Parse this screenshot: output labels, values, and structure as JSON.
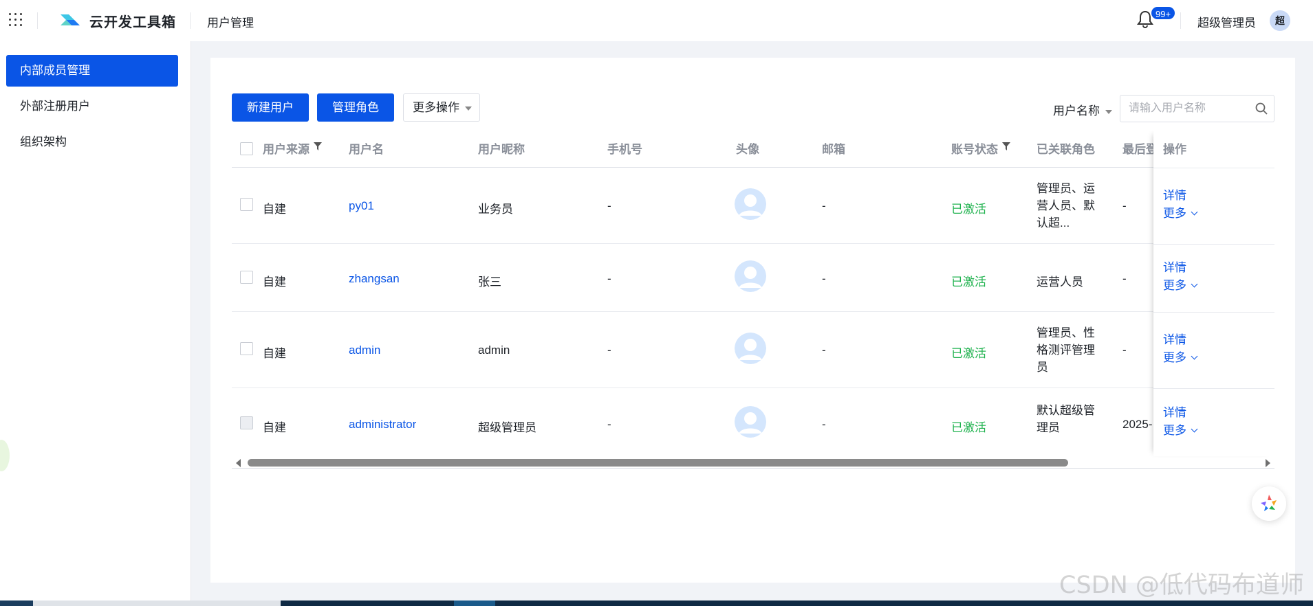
{
  "header": {
    "app_name": "云开发工具箱",
    "page_name": "用户管理",
    "notification_count": "99+",
    "user_name": "超级管理员",
    "avatar_char": "超"
  },
  "sidebar": {
    "items": [
      {
        "label": "内部成员管理",
        "active": true
      },
      {
        "label": "外部注册用户",
        "active": false
      },
      {
        "label": "组织架构",
        "active": false
      }
    ]
  },
  "toolbar": {
    "new_user": "新建用户",
    "manage_roles": "管理角色",
    "more_actions": "更多操作",
    "search_type": "用户名称",
    "search_placeholder": "请输入用户名称"
  },
  "table": {
    "columns": [
      "用户来源",
      "用户名",
      "用户昵称",
      "手机号",
      "头像",
      "邮箱",
      "账号状态",
      "已关联角色",
      "最后登录",
      "操作"
    ],
    "rows": [
      {
        "source": "自建",
        "username": "py01",
        "nickname": "业务员",
        "phone": "-",
        "email": "-",
        "status": "已激活",
        "roles": "管理员、运营人员、默认超...",
        "last_login": "-"
      },
      {
        "source": "自建",
        "username": "zhangsan",
        "nickname": "张三",
        "phone": "-",
        "email": "-",
        "status": "已激活",
        "roles": "运营人员",
        "last_login": "-"
      },
      {
        "source": "自建",
        "username": "admin",
        "nickname": "admin",
        "phone": "-",
        "email": "-",
        "status": "已激活",
        "roles": "管理员、性格测评管理员",
        "last_login": "-"
      },
      {
        "source": "自建",
        "username": "administrator",
        "nickname": "超级管理员",
        "phone": "-",
        "email": "-",
        "status": "已激活",
        "roles": "默认超级管理员",
        "last_login": "2025-"
      }
    ],
    "op_detail": "详情",
    "op_more": "更多"
  },
  "watermark": "CSDN @低代码布道师",
  "colors": {
    "primary": "#0a55e6",
    "success": "#22b350",
    "background": "#f1f3f7"
  }
}
